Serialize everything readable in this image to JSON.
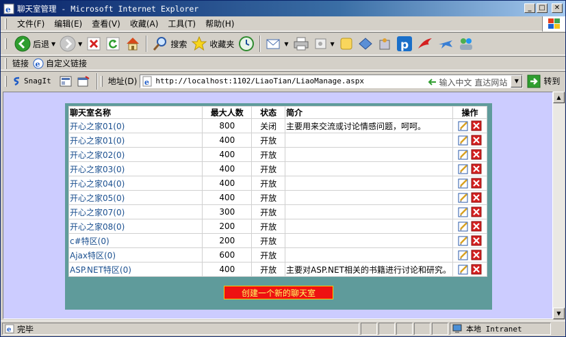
{
  "window": {
    "title": "聊天室管理 - Microsoft Internet Explorer",
    "buttons": [
      "minimize",
      "maximize",
      "close"
    ]
  },
  "menubar": {
    "items": [
      "文件(F)",
      "编辑(E)",
      "查看(V)",
      "收藏(A)",
      "工具(T)",
      "帮助(H)"
    ]
  },
  "toolbar": {
    "back_label": "后退",
    "search_label": "搜索",
    "favorites_label": "收藏夹",
    "icons": [
      "back-icon",
      "forward-icon",
      "stop-icon",
      "refresh-icon",
      "home-icon",
      "search-icon",
      "favorites-icon",
      "history-icon",
      "mail-icon",
      "print-icon",
      "edit-icon",
      "discuss-icon",
      "messenger-icon"
    ]
  },
  "linksbar": {
    "links_label": "链接",
    "custom_links_label": "自定义链接"
  },
  "addressbar": {
    "snagit_label": "SnagIt",
    "address_label": "地址(D)",
    "url": "http://localhost:1102/LiaoTian/LiaoManage.aspx",
    "hint": "输入中文 直达网站",
    "go_label": "转到"
  },
  "table": {
    "headers": {
      "name": "聊天室名称",
      "max": "最大人数",
      "status": "状态",
      "intro": "简介",
      "ops": "操作"
    },
    "rows": [
      {
        "name": "开心之家01(0)",
        "max": "800",
        "status": "关闭",
        "intro": "主要用来交流或讨论情感问题，呵呵。"
      },
      {
        "name": "开心之家01(0)",
        "max": "400",
        "status": "开放",
        "intro": ""
      },
      {
        "name": "开心之家02(0)",
        "max": "400",
        "status": "开放",
        "intro": ""
      },
      {
        "name": "开心之家03(0)",
        "max": "400",
        "status": "开放",
        "intro": ""
      },
      {
        "name": "开心之家04(0)",
        "max": "400",
        "status": "开放",
        "intro": ""
      },
      {
        "name": "开心之家05(0)",
        "max": "400",
        "status": "开放",
        "intro": ""
      },
      {
        "name": "开心之家07(0)",
        "max": "300",
        "status": "开放",
        "intro": ""
      },
      {
        "name": "开心之家08(0)",
        "max": "200",
        "status": "开放",
        "intro": ""
      },
      {
        "name": "c#特区(0)",
        "max": "200",
        "status": "开放",
        "intro": ""
      },
      {
        "name": "Ajax特区(0)",
        "max": "600",
        "status": "开放",
        "intro": ""
      },
      {
        "name": "ASP.NET特区(0)",
        "max": "400",
        "status": "开放",
        "intro": "主要对ASP.NET相关的书籍进行讨论和研究。"
      }
    ]
  },
  "create_button_label": "创建一个新的聊天室",
  "statusbar": {
    "status_text": "完毕",
    "zone_text": "本地 Intranet"
  },
  "colors": {
    "page_background": "#ccccff",
    "panel_background": "#5f9b9b",
    "create_button": "#ee1111",
    "link_text": "#1a4f8f"
  }
}
